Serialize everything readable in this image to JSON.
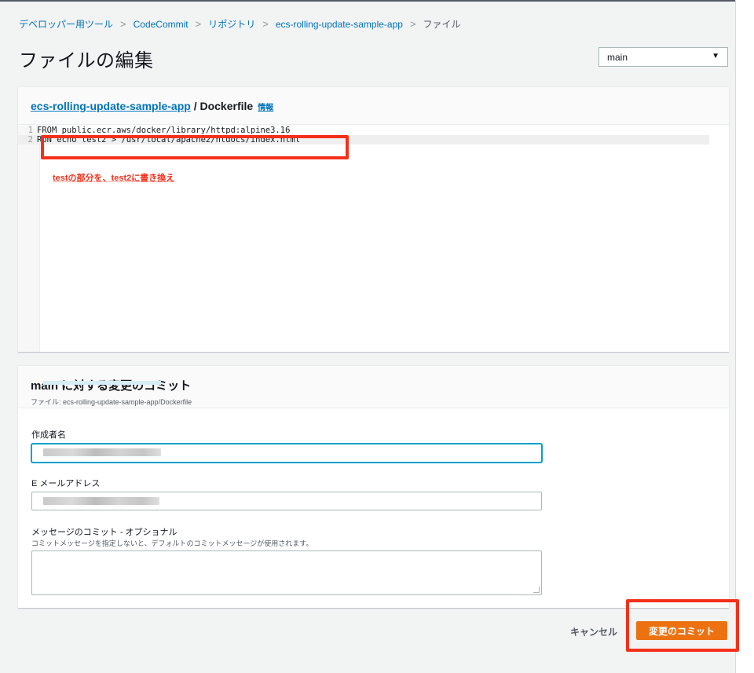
{
  "breadcrumb": {
    "items": [
      "デベロッパー用ツール",
      "CodeCommit",
      "リポジトリ",
      "ecs-rolling-update-sample-app"
    ],
    "current": "ファイル",
    "separator": ">"
  },
  "page": {
    "title": "ファイルの編集"
  },
  "branch": {
    "selected": "main",
    "caret": "▼"
  },
  "editor": {
    "repo": "ecs-rolling-update-sample-app",
    "path": " / Dockerfile",
    "info": "情報",
    "lines": [
      {
        "num": "1",
        "text": "FROM public.ecr.aws/docker/library/httpd:alpine3.16"
      },
      {
        "num": "2",
        "text": "RUN echo test2 > /usr/local/apache2/htdocs/index.html"
      }
    ],
    "annotation": "testの部分を、test2に書き換え"
  },
  "commit": {
    "title": "main に対する変更のコミット",
    "subtitle": "ファイル: ecs-rolling-update-sample-app/Dockerfile",
    "author_label": "作成者名",
    "email_label": "E メールアドレス",
    "message_label": "メッセージのコミット - オプショナル",
    "message_desc": "コミットメッセージを指定しないと、デフォルトのコミットメッセージが使用されます。"
  },
  "actions": {
    "cancel": "キャンセル",
    "commit": "変更のコミット"
  },
  "colors": {
    "link": "#0073bb",
    "primary": "#ec7211",
    "highlight": "#f4301b",
    "focus": "#00a1c9"
  }
}
